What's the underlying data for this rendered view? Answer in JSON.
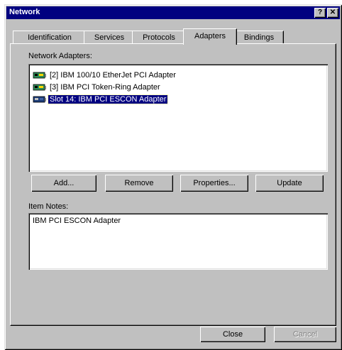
{
  "window": {
    "title": "Network",
    "help_label": "?",
    "close_label": "✕"
  },
  "tabs": [
    {
      "label": "Identification"
    },
    {
      "label": "Services"
    },
    {
      "label": "Protocols"
    },
    {
      "label": "Adapters",
      "active": true
    },
    {
      "label": "Bindings"
    }
  ],
  "adapters": {
    "label": "Network Adapters:",
    "items": [
      {
        "label": "[2] IBM 100/10 EtherJet PCI Adapter",
        "icon": "network-card-icon",
        "selected": false
      },
      {
        "label": "[3] IBM PCI Token-Ring Adapter",
        "icon": "network-card-icon",
        "selected": false
      },
      {
        "label": "Slot 14: IBM PCI ESCON Adapter",
        "icon": "escon-adapter-icon",
        "selected": true
      }
    ]
  },
  "actions": {
    "add": "Add...",
    "remove": "Remove",
    "properties": "Properties...",
    "update": "Update"
  },
  "notes": {
    "label": "Item Notes:",
    "text": "IBM PCI ESCON Adapter"
  },
  "footer": {
    "close": "Close",
    "cancel": "Cancel"
  },
  "colors": {
    "titlebar": "#000080",
    "face": "#c0c0c0",
    "selection": "#000080",
    "card_green": "#2e8b57"
  }
}
